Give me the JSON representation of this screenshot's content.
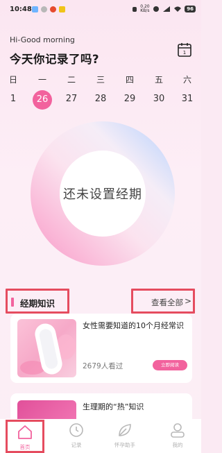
{
  "status_bar": {
    "time": "10:48",
    "net_speed": "0.20\nKB/s",
    "battery": "96"
  },
  "header": {
    "greeting": "Hi-Good morning",
    "title": "今天你记录了吗?",
    "calendar_icon": "calendar-icon"
  },
  "week": {
    "days": [
      "日",
      "一",
      "二",
      "三",
      "四",
      "五",
      "六"
    ],
    "dates": [
      "1",
      "26",
      "27",
      "28",
      "29",
      "30",
      "31"
    ],
    "today_index": 1
  },
  "cycle": {
    "label": "还未设置经期"
  },
  "knowledge": {
    "title": "经期知识",
    "view_all": "查看全部",
    "view_all_chevron": ">"
  },
  "articles": [
    {
      "title": "女性需要知道的10个月经常识",
      "views": "2679人看过",
      "button": "立即阅读"
    },
    {
      "title": "生理期的“热”知识"
    }
  ],
  "tabbar": {
    "items": [
      {
        "label": "首页",
        "icon": "home-icon"
      },
      {
        "label": "记录",
        "icon": "clock-icon"
      },
      {
        "label": "怀孕助手",
        "icon": "leaf-icon"
      },
      {
        "label": "我的",
        "icon": "user-icon"
      }
    ]
  },
  "colors": {
    "accent": "#f2629d",
    "highlight_border": "#e54c5f"
  }
}
